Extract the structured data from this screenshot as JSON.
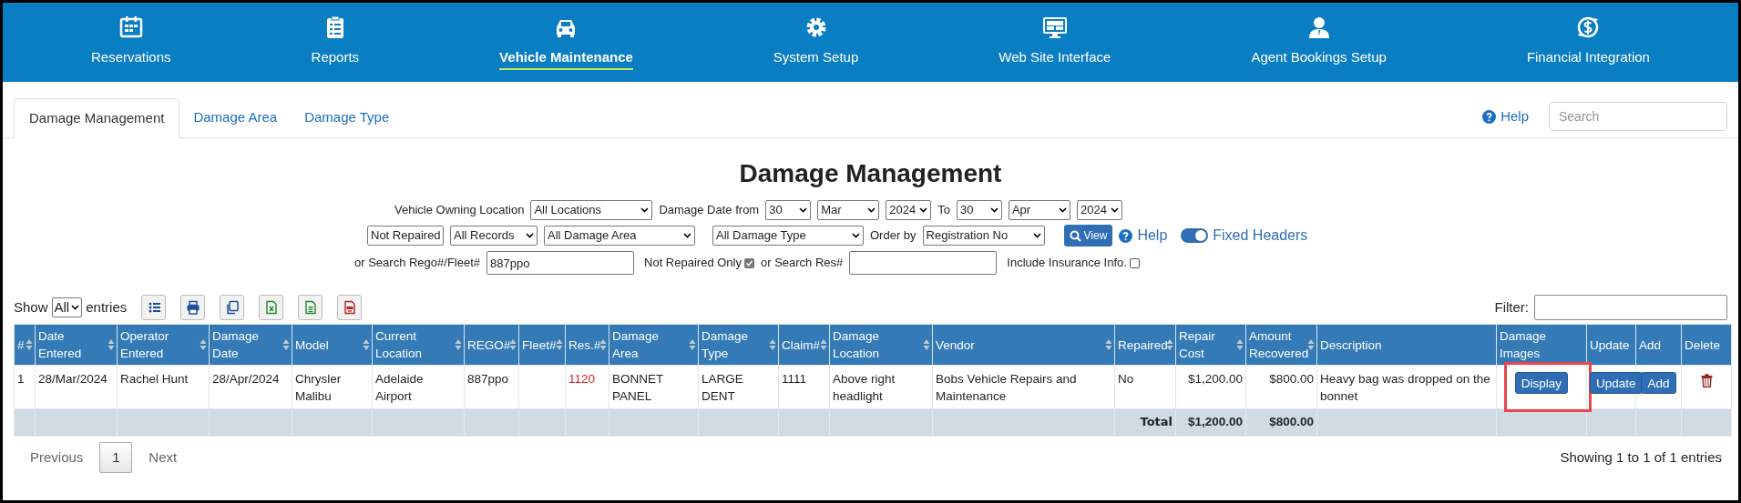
{
  "nav": [
    {
      "label": "Reservations",
      "selected": false
    },
    {
      "label": "Reports",
      "selected": false
    },
    {
      "label": "Vehicle Maintenance",
      "selected": true
    },
    {
      "label": "System Setup",
      "selected": false
    },
    {
      "label": "Web Site Interface",
      "selected": false
    },
    {
      "label": "Agent Bookings Setup",
      "selected": false
    },
    {
      "label": "Financial Integration",
      "selected": false
    }
  ],
  "tabs": [
    {
      "label": "Damage Management",
      "selected": true
    },
    {
      "label": "Damage Area",
      "selected": false
    },
    {
      "label": "Damage Type",
      "selected": false
    }
  ],
  "help_link": "Help",
  "search": {
    "placeholder": "Search"
  },
  "title": "Damage Management",
  "filter_rows": [
    [
      {
        "kind": "label",
        "text": "Vehicle Owning Location"
      },
      {
        "kind": "select",
        "text": "All Locations"
      },
      {
        "kind": "label",
        "text": "Damage Date from"
      },
      {
        "kind": "select",
        "text": "30"
      },
      {
        "kind": "select",
        "text": "Mar"
      },
      {
        "kind": "select",
        "text": "2024"
      },
      {
        "kind": "label",
        "text": "To"
      },
      {
        "kind": "select",
        "text": "30"
      },
      {
        "kind": "select",
        "text": "Apr"
      },
      {
        "kind": "select",
        "text": "2024"
      }
    ],
    [
      {
        "kind": "select",
        "text": "Not Repaired"
      },
      {
        "kind": "select",
        "text": "All Records"
      },
      {
        "kind": "select",
        "text": "All Damage Area"
      },
      {
        "kind": "select",
        "text": "All Damage Type"
      },
      {
        "kind": "label",
        "text": "Order by"
      },
      {
        "kind": "select",
        "text": "Registration No"
      },
      {
        "kind": "button",
        "text": "View"
      },
      {
        "kind": "help",
        "text": "Help"
      },
      {
        "kind": "toggle",
        "text": "Fixed Headers",
        "on": true
      }
    ],
    [
      {
        "kind": "label",
        "text": "or Search Rego#/Fleet#"
      },
      {
        "kind": "input",
        "text": "887ppo"
      },
      {
        "kind": "checkbox",
        "text": "Not Repaired Only",
        "checked": true
      },
      {
        "kind": "label",
        "text": "or Search Res#"
      },
      {
        "kind": "input"
      },
      {
        "kind": "checkbox",
        "text": "Include Insurance Info.",
        "checked": false
      }
    ]
  ],
  "length_menu": {
    "before": "Show",
    "value": "All",
    "after": "entries"
  },
  "export_buttons": [
    {
      "kind": "list"
    },
    {
      "kind": "print"
    },
    {
      "kind": "copy"
    },
    {
      "kind": "excel"
    },
    {
      "kind": "csv"
    },
    {
      "kind": "pdf"
    }
  ],
  "filter_label": "Filter:",
  "table": {
    "columns": [
      {
        "label": "#",
        "sortable": true
      },
      {
        "label": "Date Entered",
        "sortable": true
      },
      {
        "label": "Operator Entered",
        "sortable": true
      },
      {
        "label": "Damage Date",
        "sortable": true
      },
      {
        "label": "Model",
        "sortable": true
      },
      {
        "label": "Current Location",
        "sortable": true
      },
      {
        "label": "REGO#",
        "sortable": true
      },
      {
        "label": "Fleet#",
        "sortable": true
      },
      {
        "label": "Res.#",
        "sortable": true
      },
      {
        "label": "Damage Area",
        "sortable": true
      },
      {
        "label": "Damage Type",
        "sortable": true
      },
      {
        "label": "Claim#",
        "sortable": true
      },
      {
        "label": "Damage Location",
        "sortable": true
      },
      {
        "label": "Vendor",
        "sortable": true
      },
      {
        "label": "Repaired",
        "sortable": true
      },
      {
        "label": "Repair Cost",
        "sortable": true
      },
      {
        "label": "Amount Recovered",
        "sortable": true
      },
      {
        "label": "Description",
        "sortable": false
      },
      {
        "label": "Damage Images",
        "sortable": false
      },
      {
        "label": "Update",
        "sortable": false
      },
      {
        "label": "Add",
        "sortable": false
      },
      {
        "label": "Delete",
        "sortable": false
      }
    ],
    "rows": [
      {
        "cells": [
          {
            "text": "1"
          },
          {
            "text": "28/Mar/2024"
          },
          {
            "text": "Rachel Hunt"
          },
          {
            "text": "28/Apr/2024"
          },
          {
            "text": "Chrysler Malibu"
          },
          {
            "text": "Adelaide Airport"
          },
          {
            "text": "887ppo"
          },
          {
            "kind": "empty"
          },
          {
            "kind": "link",
            "text": "1120"
          },
          {
            "text": "BONNET PANEL"
          },
          {
            "text": "LARGE DENT"
          },
          {
            "text": "1111"
          },
          {
            "text": "Above right headlight"
          },
          {
            "text": "Bobs Vehicle Repairs and Maintenance"
          },
          {
            "text": "No"
          },
          {
            "kind": "money",
            "text": "$1,200.00"
          },
          {
            "kind": "money",
            "text": "$800.00"
          },
          {
            "text": "Heavy bag was dropped on the bonnet"
          },
          {
            "kind": "button",
            "text": "Display",
            "highlighted": true
          },
          {
            "kind": "button",
            "text": "Update"
          },
          {
            "kind": "button",
            "text": "Add"
          },
          {
            "kind": "delete"
          }
        ]
      }
    ],
    "total": {
      "label": "Total",
      "repair_cost": "$1,200.00",
      "amount_recovered": "$800.00"
    }
  },
  "pagination": [
    {
      "label": "Previous",
      "selected": false
    },
    {
      "label": "1",
      "selected": true
    },
    {
      "label": "Next",
      "selected": false
    }
  ],
  "info": "Showing 1 to 1 of 1 entries"
}
